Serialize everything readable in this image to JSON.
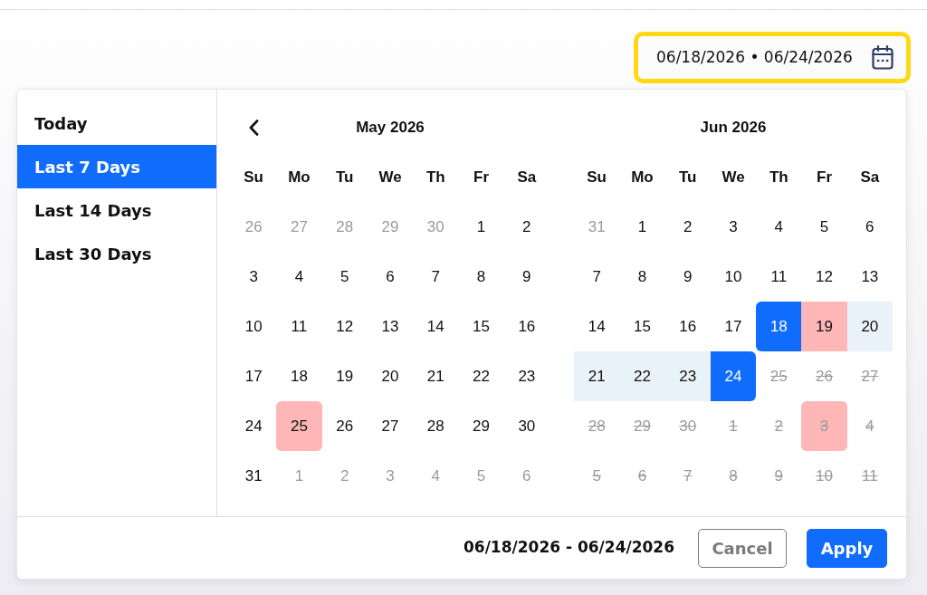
{
  "date_field": {
    "value": "06/18/2026 • 06/24/2026",
    "highlighted": true
  },
  "presets": [
    {
      "label": "Today",
      "selected": false
    },
    {
      "label": "Last 7 Days",
      "selected": true
    },
    {
      "label": "Last 14 Days",
      "selected": false
    },
    {
      "label": "Last 30 Days",
      "selected": false
    }
  ],
  "months": [
    {
      "title": "May 2026",
      "show_prev": true,
      "weekdays": [
        "Su",
        "Mo",
        "Tu",
        "We",
        "Th",
        "Fr",
        "Sa"
      ],
      "days": [
        {
          "label": "26",
          "kind": "outside",
          "selected": false,
          "in_range": false,
          "holiday": false
        },
        {
          "label": "27",
          "kind": "outside",
          "selected": false,
          "in_range": false,
          "holiday": false
        },
        {
          "label": "28",
          "kind": "outside",
          "selected": false,
          "in_range": false,
          "holiday": false
        },
        {
          "label": "29",
          "kind": "outside",
          "selected": false,
          "in_range": false,
          "holiday": false
        },
        {
          "label": "30",
          "kind": "outside",
          "selected": false,
          "in_range": false,
          "holiday": false
        },
        {
          "label": "1",
          "kind": "current",
          "selected": false,
          "in_range": false,
          "holiday": false
        },
        {
          "label": "2",
          "kind": "current",
          "selected": false,
          "in_range": false,
          "holiday": false
        },
        {
          "label": "3",
          "kind": "current",
          "selected": false,
          "in_range": false,
          "holiday": false
        },
        {
          "label": "4",
          "kind": "current",
          "selected": false,
          "in_range": false,
          "holiday": false
        },
        {
          "label": "5",
          "kind": "current",
          "selected": false,
          "in_range": false,
          "holiday": false
        },
        {
          "label": "6",
          "kind": "current",
          "selected": false,
          "in_range": false,
          "holiday": false
        },
        {
          "label": "7",
          "kind": "current",
          "selected": false,
          "in_range": false,
          "holiday": false
        },
        {
          "label": "8",
          "kind": "current",
          "selected": false,
          "in_range": false,
          "holiday": false
        },
        {
          "label": "9",
          "kind": "current",
          "selected": false,
          "in_range": false,
          "holiday": false
        },
        {
          "label": "10",
          "kind": "current",
          "selected": false,
          "in_range": false,
          "holiday": false
        },
        {
          "label": "11",
          "kind": "current",
          "selected": false,
          "in_range": false,
          "holiday": false
        },
        {
          "label": "12",
          "kind": "current",
          "selected": false,
          "in_range": false,
          "holiday": false
        },
        {
          "label": "13",
          "kind": "current",
          "selected": false,
          "in_range": false,
          "holiday": false
        },
        {
          "label": "14",
          "kind": "current",
          "selected": false,
          "in_range": false,
          "holiday": false
        },
        {
          "label": "15",
          "kind": "current",
          "selected": false,
          "in_range": false,
          "holiday": false
        },
        {
          "label": "16",
          "kind": "current",
          "selected": false,
          "in_range": false,
          "holiday": false
        },
        {
          "label": "17",
          "kind": "current",
          "selected": false,
          "in_range": false,
          "holiday": false
        },
        {
          "label": "18",
          "kind": "current",
          "selected": false,
          "in_range": false,
          "holiday": false
        },
        {
          "label": "19",
          "kind": "current",
          "selected": false,
          "in_range": false,
          "holiday": false
        },
        {
          "label": "20",
          "kind": "current",
          "selected": false,
          "in_range": false,
          "holiday": false
        },
        {
          "label": "21",
          "kind": "current",
          "selected": false,
          "in_range": false,
          "holiday": false
        },
        {
          "label": "22",
          "kind": "current",
          "selected": false,
          "in_range": false,
          "holiday": false
        },
        {
          "label": "23",
          "kind": "current",
          "selected": false,
          "in_range": false,
          "holiday": false
        },
        {
          "label": "24",
          "kind": "current",
          "selected": false,
          "in_range": false,
          "holiday": false
        },
        {
          "label": "25",
          "kind": "current",
          "selected": false,
          "in_range": false,
          "holiday": true
        },
        {
          "label": "26",
          "kind": "current",
          "selected": false,
          "in_range": false,
          "holiday": false
        },
        {
          "label": "27",
          "kind": "current",
          "selected": false,
          "in_range": false,
          "holiday": false
        },
        {
          "label": "28",
          "kind": "current",
          "selected": false,
          "in_range": false,
          "holiday": false
        },
        {
          "label": "29",
          "kind": "current",
          "selected": false,
          "in_range": false,
          "holiday": false
        },
        {
          "label": "30",
          "kind": "current",
          "selected": false,
          "in_range": false,
          "holiday": false
        },
        {
          "label": "31",
          "kind": "current",
          "selected": false,
          "in_range": false,
          "holiday": false
        },
        {
          "label": "1",
          "kind": "outside",
          "selected": false,
          "in_range": false,
          "holiday": false
        },
        {
          "label": "2",
          "kind": "outside",
          "selected": false,
          "in_range": false,
          "holiday": false
        },
        {
          "label": "3",
          "kind": "outside",
          "selected": false,
          "in_range": false,
          "holiday": false
        },
        {
          "label": "4",
          "kind": "outside",
          "selected": false,
          "in_range": false,
          "holiday": false
        },
        {
          "label": "5",
          "kind": "outside",
          "selected": false,
          "in_range": false,
          "holiday": false
        },
        {
          "label": "6",
          "kind": "outside",
          "selected": false,
          "in_range": false,
          "holiday": false
        }
      ]
    },
    {
      "title": "Jun 2026",
      "show_prev": false,
      "weekdays": [
        "Su",
        "Mo",
        "Tu",
        "We",
        "Th",
        "Fr",
        "Sa"
      ],
      "days": [
        {
          "label": "31",
          "kind": "outside",
          "selected": false,
          "in_range": false,
          "holiday": false
        },
        {
          "label": "1",
          "kind": "current",
          "selected": false,
          "in_range": false,
          "holiday": false
        },
        {
          "label": "2",
          "kind": "current",
          "selected": false,
          "in_range": false,
          "holiday": false
        },
        {
          "label": "3",
          "kind": "current",
          "selected": false,
          "in_range": false,
          "holiday": false
        },
        {
          "label": "4",
          "kind": "current",
          "selected": false,
          "in_range": false,
          "holiday": false
        },
        {
          "label": "5",
          "kind": "current",
          "selected": false,
          "in_range": false,
          "holiday": false
        },
        {
          "label": "6",
          "kind": "current",
          "selected": false,
          "in_range": false,
          "holiday": false
        },
        {
          "label": "7",
          "kind": "current",
          "selected": false,
          "in_range": false,
          "holiday": false
        },
        {
          "label": "8",
          "kind": "current",
          "selected": false,
          "in_range": false,
          "holiday": false
        },
        {
          "label": "9",
          "kind": "current",
          "selected": false,
          "in_range": false,
          "holiday": false
        },
        {
          "label": "10",
          "kind": "current",
          "selected": false,
          "in_range": false,
          "holiday": false
        },
        {
          "label": "11",
          "kind": "current",
          "selected": false,
          "in_range": false,
          "holiday": false
        },
        {
          "label": "12",
          "kind": "current",
          "selected": false,
          "in_range": false,
          "holiday": false
        },
        {
          "label": "13",
          "kind": "current",
          "selected": false,
          "in_range": false,
          "holiday": false
        },
        {
          "label": "14",
          "kind": "current",
          "selected": false,
          "in_range": false,
          "holiday": false
        },
        {
          "label": "15",
          "kind": "current",
          "selected": false,
          "in_range": false,
          "holiday": false
        },
        {
          "label": "16",
          "kind": "current",
          "selected": false,
          "in_range": false,
          "holiday": false
        },
        {
          "label": "17",
          "kind": "current",
          "selected": false,
          "in_range": false,
          "holiday": false
        },
        {
          "label": "18",
          "kind": "current",
          "selected": true,
          "in_range": true,
          "holiday": false
        },
        {
          "label": "19",
          "kind": "current",
          "selected": false,
          "in_range": true,
          "holiday": true
        },
        {
          "label": "20",
          "kind": "current",
          "selected": false,
          "in_range": true,
          "holiday": false
        },
        {
          "label": "21",
          "kind": "current",
          "selected": false,
          "in_range": true,
          "holiday": false
        },
        {
          "label": "22",
          "kind": "current",
          "selected": false,
          "in_range": true,
          "holiday": false
        },
        {
          "label": "23",
          "kind": "current",
          "selected": false,
          "in_range": true,
          "holiday": false
        },
        {
          "label": "24",
          "kind": "current",
          "selected": true,
          "in_range": true,
          "holiday": false
        },
        {
          "label": "25",
          "kind": "disabled",
          "selected": false,
          "in_range": false,
          "holiday": false
        },
        {
          "label": "26",
          "kind": "disabled",
          "selected": false,
          "in_range": false,
          "holiday": false
        },
        {
          "label": "27",
          "kind": "disabled",
          "selected": false,
          "in_range": false,
          "holiday": false
        },
        {
          "label": "28",
          "kind": "disabled",
          "selected": false,
          "in_range": false,
          "holiday": false
        },
        {
          "label": "29",
          "kind": "disabled",
          "selected": false,
          "in_range": false,
          "holiday": false
        },
        {
          "label": "30",
          "kind": "disabled",
          "selected": false,
          "in_range": false,
          "holiday": false
        },
        {
          "label": "1",
          "kind": "disabled",
          "selected": false,
          "in_range": false,
          "holiday": false
        },
        {
          "label": "2",
          "kind": "disabled",
          "selected": false,
          "in_range": false,
          "holiday": false
        },
        {
          "label": "3",
          "kind": "disabled",
          "selected": false,
          "in_range": false,
          "holiday": true
        },
        {
          "label": "4",
          "kind": "disabled",
          "selected": false,
          "in_range": false,
          "holiday": false
        },
        {
          "label": "5",
          "kind": "disabled",
          "selected": false,
          "in_range": false,
          "holiday": false
        },
        {
          "label": "6",
          "kind": "disabled",
          "selected": false,
          "in_range": false,
          "holiday": false
        },
        {
          "label": "7",
          "kind": "disabled",
          "selected": false,
          "in_range": false,
          "holiday": false
        },
        {
          "label": "8",
          "kind": "disabled",
          "selected": false,
          "in_range": false,
          "holiday": false
        },
        {
          "label": "9",
          "kind": "disabled",
          "selected": false,
          "in_range": false,
          "holiday": false
        },
        {
          "label": "10",
          "kind": "disabled",
          "selected": false,
          "in_range": false,
          "holiday": false
        },
        {
          "label": "11",
          "kind": "disabled",
          "selected": false,
          "in_range": false,
          "holiday": false
        }
      ]
    }
  ],
  "footer": {
    "range_text": "06/18/2026 - 06/24/2026",
    "buttons": [
      {
        "label": "Cancel",
        "kind": "secondary"
      },
      {
        "label": "Apply",
        "kind": "primary"
      }
    ]
  }
}
